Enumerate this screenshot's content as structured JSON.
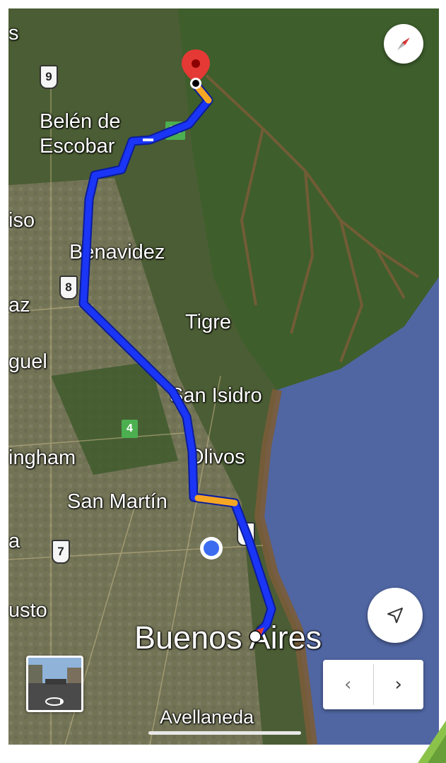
{
  "map": {
    "imagery": "satellite",
    "colors": {
      "land": "#4a5a33",
      "urban": "#7b7a5c",
      "delta": "#3f5f2e",
      "water": "#5066a3",
      "route": "#1a35f5",
      "traffic": "#f5a623",
      "shoreline": "#7a5c38"
    },
    "places": [
      {
        "id": "belen-de-escobar",
        "line1": "Belén de",
        "line2": "Escobar"
      },
      {
        "id": "benavidez",
        "line1": "Benavidez",
        "line2": ""
      },
      {
        "id": "tigre",
        "line1": "Tigre",
        "line2": ""
      },
      {
        "id": "san-isidro",
        "line1": "San Isidro",
        "line2": ""
      },
      {
        "id": "olivos",
        "line1": "Olivos",
        "line2": ""
      },
      {
        "id": "san-martin",
        "line1": "San Martín",
        "line2": ""
      },
      {
        "id": "buenos-aires",
        "line1": "Buenos Aires",
        "line2": ""
      },
      {
        "id": "avellaneda",
        "line1": "Avellaneda",
        "line2": ""
      }
    ],
    "edge_labels": [
      "s",
      "iso",
      "az",
      "guel",
      "ingham",
      "a",
      "usto"
    ],
    "route_shields": [
      "9",
      "8",
      "7",
      "9"
    ],
    "green_badges": [
      "25",
      "4"
    ]
  },
  "controls": {
    "compass_icon": "compass-icon",
    "locate_icon": "navigation-arrow-icon",
    "prev_label": "‹",
    "next_label": "›",
    "street_view_icon": "street-view-rotate-icon"
  }
}
